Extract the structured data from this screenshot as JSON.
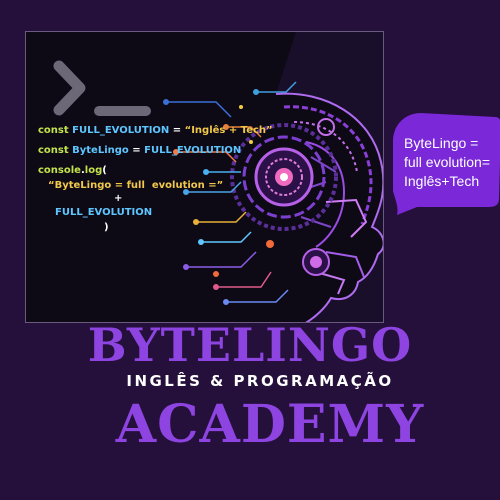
{
  "code": {
    "line1": {
      "kw": "const",
      "id": "FULL_EVOLUTION",
      "op": " = ",
      "st": "“Inglês + Tech”"
    },
    "line2": {
      "kw": "const",
      "id": "ByteLingo",
      "op": " = ",
      "id2": "FULL_EVOLUTION"
    },
    "line3": {
      "kw": "console",
      "op": ".",
      "fn": "log",
      "paren": "("
    },
    "line4": {
      "st": "“ByteLingo = full  evolution =”"
    },
    "line5": {
      "op": "+"
    },
    "line6": {
      "id": "FULL_EVOLUTION"
    },
    "line7": {
      "op": ")"
    }
  },
  "bubble": {
    "line1": "ByteLingo =",
    "line2": "full evolution=",
    "line3": "Inglês+Tech"
  },
  "brand": {
    "title": "BYTELINGO",
    "subtitle": "INGLÊS & PROGRAMAÇÃO",
    "title2": "ACADEMY"
  },
  "colors": {
    "background": "#250f3b",
    "accent": "#8d44e0",
    "keyword": "#c3e34b",
    "identifier": "#5ec7ff",
    "string": "#f2c84b"
  }
}
